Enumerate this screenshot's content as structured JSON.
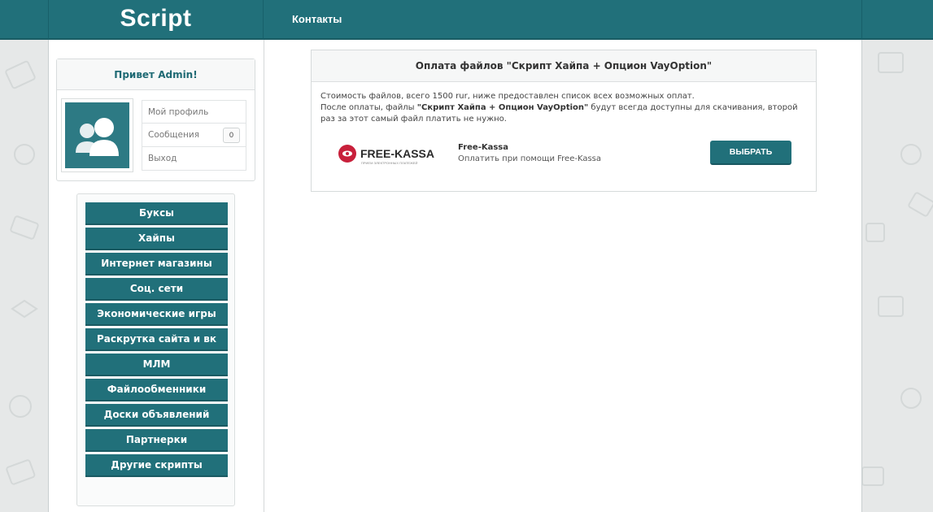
{
  "header": {
    "logo": "Script",
    "nav": [
      {
        "label": "Контакты"
      }
    ]
  },
  "user_panel": {
    "greeting": "Привет Admin!",
    "menu": [
      {
        "label": "Мой профиль"
      },
      {
        "label": "Сообщения",
        "badge": "0"
      },
      {
        "label": "Выход"
      }
    ]
  },
  "categories": [
    {
      "label": "Буксы"
    },
    {
      "label": "Хайпы"
    },
    {
      "label": "Интернет магазины"
    },
    {
      "label": "Соц. сети"
    },
    {
      "label": "Экономические игры"
    },
    {
      "label": "Раскрутка сайта и вк"
    },
    {
      "label": "МЛМ"
    },
    {
      "label": "Файлообменники"
    },
    {
      "label": "Доски объявлений"
    },
    {
      "label": "Партнерки"
    },
    {
      "label": "Другие скрипты"
    }
  ],
  "payment": {
    "title": "Оплата файлов \"Скрипт Хайпа + Опцион VayOption\"",
    "line1": "Стоимость файлов, всего 1500 rur, ниже предоставлен список всех возможных оплат.",
    "line2_prefix": "После оплаты, файлы ",
    "line2_bold": "\"Скрипт Хайпа + Опцион VayOption\"",
    "line2_suffix": " будут всегда доступны для скачивания, второй раз за этот самый файл платить не нужно.",
    "method": {
      "logo_text": "FREE-KASSA",
      "logo_tagline": "ПРИЕМ ЭЛЕКТРОННЫХ ПЛАТЕЖЕЙ",
      "name": "Free-Kassa",
      "description": "Оплатить при помощи Free-Kassa",
      "button": "ВЫБРАТЬ"
    }
  },
  "colors": {
    "accent": "#21707a",
    "logo_red": "#c8203b"
  }
}
